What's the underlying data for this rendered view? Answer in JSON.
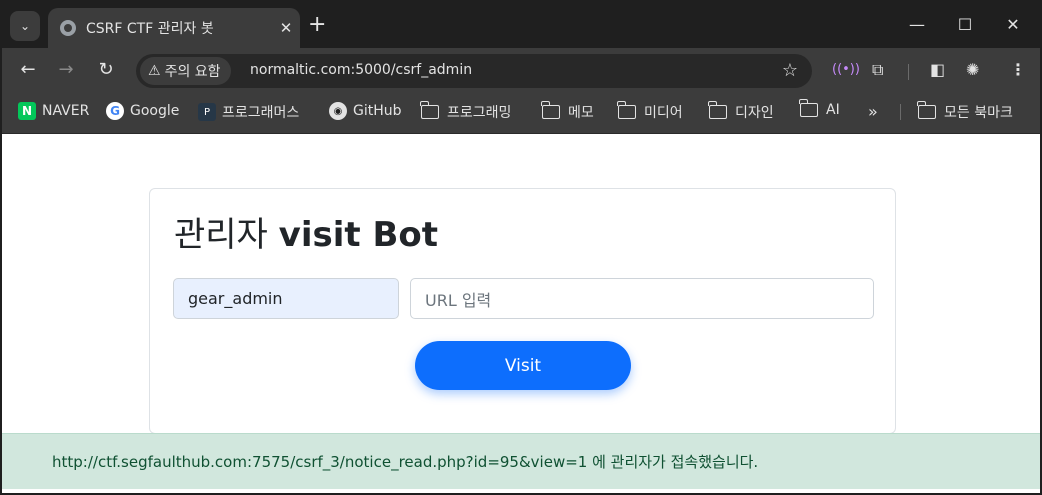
{
  "tab": {
    "title": "CSRF CTF 관리자 봇",
    "close": "✕",
    "new_tab": "+"
  },
  "window": {
    "minimize": "—",
    "maximize": "☐",
    "close": "✕"
  },
  "toolbar": {
    "back": "←",
    "forward": "→",
    "reload": "↻",
    "security_label": "주의 요함",
    "security_icon": "⚠",
    "url": "normaltic.com:5000/csrf_admin",
    "star": "☆"
  },
  "bookmarks": {
    "items": [
      {
        "label": "NAVER",
        "icon": "N"
      },
      {
        "label": "Google",
        "icon": "G"
      },
      {
        "label": "프로그래머스",
        "icon": "P"
      },
      {
        "label": "GitHub",
        "icon": "◉"
      },
      {
        "label": "프로그래밍",
        "icon": "folder"
      },
      {
        "label": "메모",
        "icon": "folder"
      },
      {
        "label": "미디어",
        "icon": "folder"
      },
      {
        "label": "디자인",
        "icon": "folder"
      },
      {
        "label": "AI",
        "icon": "folder"
      }
    ],
    "overflow": "»",
    "all_bookmarks": "모든 북마크"
  },
  "page": {
    "title_ko": "관리자",
    "title_en": "visit Bot",
    "user_value": "gear_admin",
    "url_placeholder": "URL 입력",
    "visit_label": "Visit",
    "alert_text": "http://ctf.segfaulthub.com:7575/csrf_3/notice_read.php?id=95&view=1 에 관리자가 접속했습니다."
  },
  "colors": {
    "primary": "#0d6efd",
    "alert_bg": "#d1e7dd",
    "alert_text": "#0f5132",
    "chrome_dark": "#1f1f1f",
    "chrome_toolbar": "#3c3c3c"
  }
}
